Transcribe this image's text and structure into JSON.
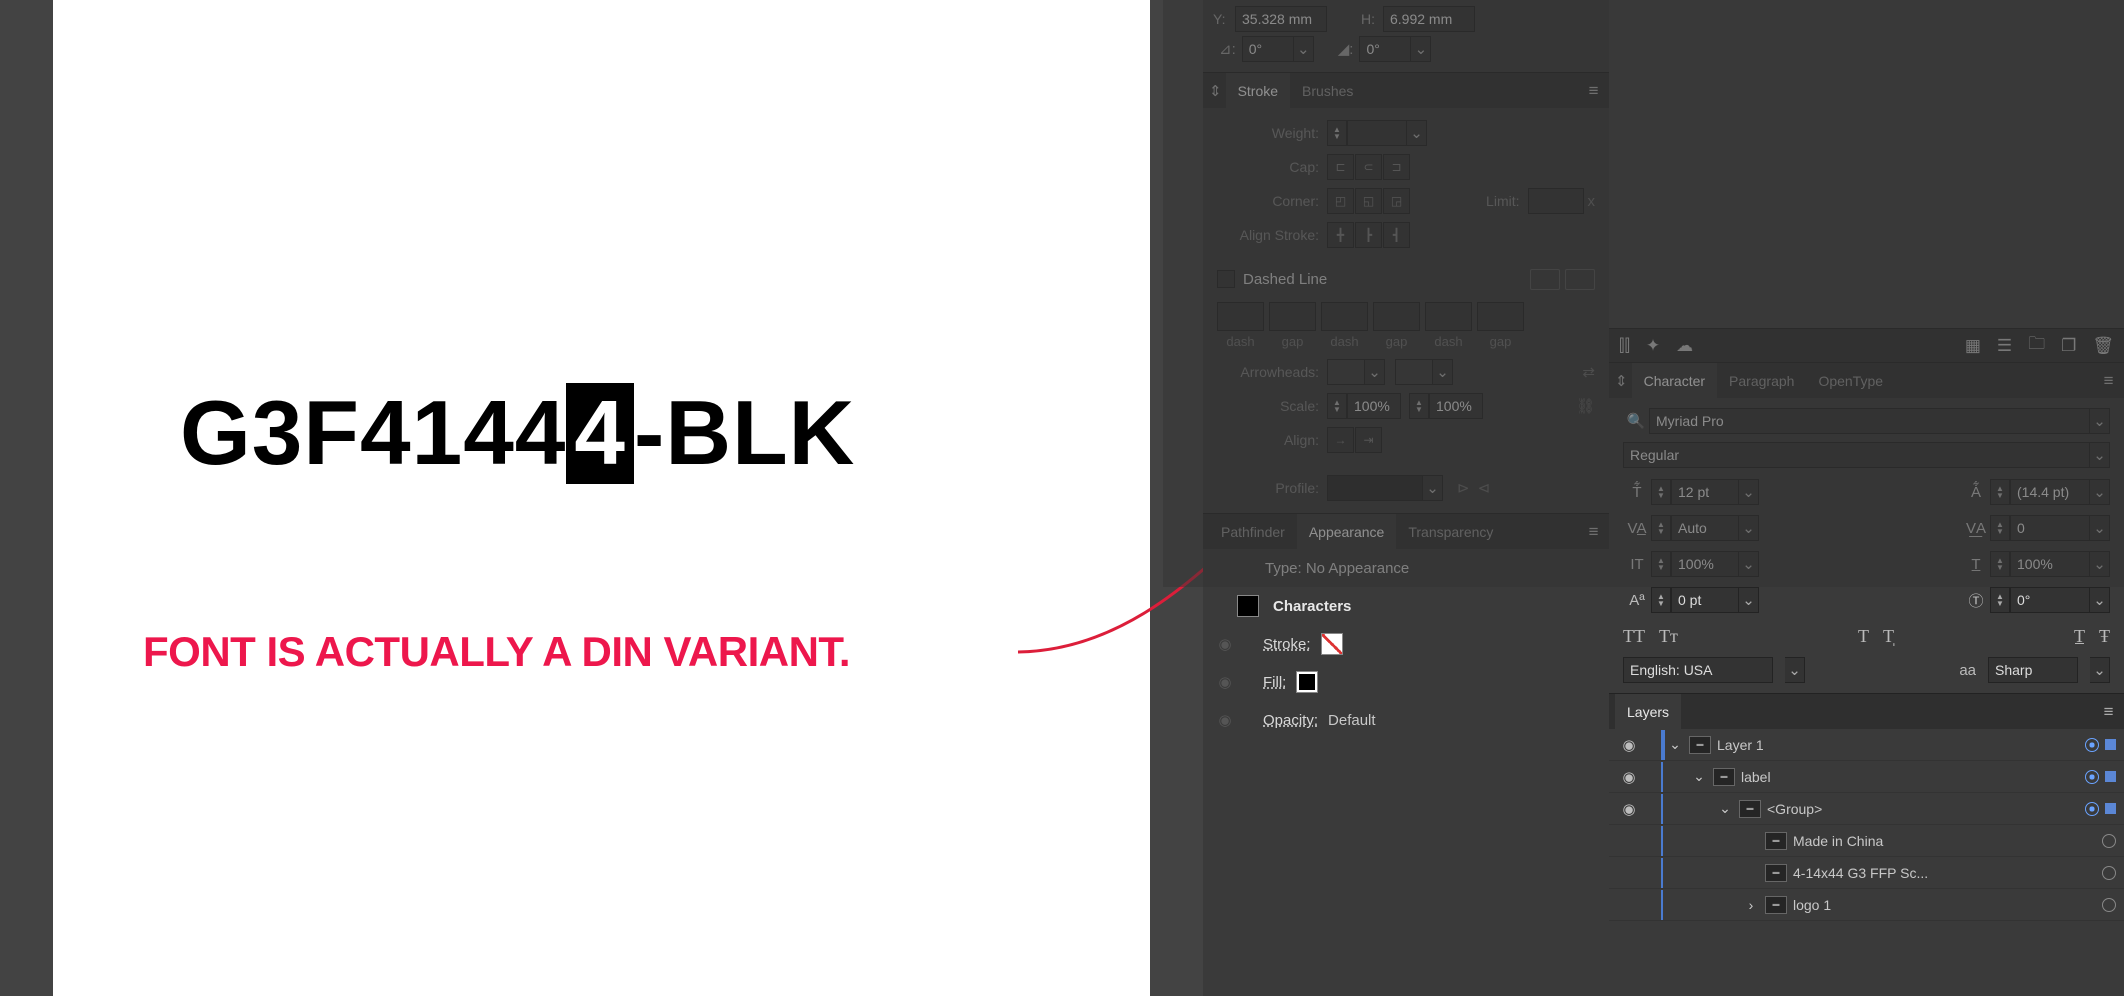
{
  "canvas": {
    "text_pre": "G3F4144",
    "text_inv": "4",
    "text_post": "-BLK",
    "annotation": "FONT IS ACTUALLY A DIN VARIANT."
  },
  "transform": {
    "y_label": "Y:",
    "y_value": "35.328 mm",
    "h_label": "H:",
    "h_value": "6.992 mm",
    "rotate": "0°",
    "shear": "0°"
  },
  "stroke_panel": {
    "tab_stroke": "Stroke",
    "tab_brushes": "Brushes",
    "weight_lbl": "Weight:",
    "cap_lbl": "Cap:",
    "corner_lbl": "Corner:",
    "limit_lbl": "Limit:",
    "align_lbl": "Align Stroke:",
    "dashed_lbl": "Dashed Line",
    "dash": "dash",
    "gap": "gap",
    "arrow_lbl": "Arrowheads:",
    "scale_lbl": "Scale:",
    "scale1": "100%",
    "scale2": "100%",
    "align2_lbl": "Align:",
    "profile_lbl": "Profile:",
    "x": "x"
  },
  "appearance_panel": {
    "tab_pathfinder": "Pathfinder",
    "tab_appearance": "Appearance",
    "tab_transparency": "Transparency",
    "type_line": "Type: No Appearance",
    "characters": "Characters",
    "stroke": "Stroke:",
    "fill": "Fill:",
    "opacity": "Opacity:",
    "opacity_val": "Default"
  },
  "character_panel": {
    "tab_character": "Character",
    "tab_paragraph": "Paragraph",
    "tab_opentype": "OpenType",
    "font": "Myriad Pro",
    "style": "Regular",
    "size": "12 pt",
    "leading": "(14.4 pt)",
    "kerning": "Auto",
    "tracking": "0",
    "vscale": "100%",
    "hscale": "100%",
    "baseline": "0 pt",
    "rotation": "0°",
    "language": "English: USA",
    "aa": "Sharp",
    "aa_lbl": "aa"
  },
  "layers_panel": {
    "tab": "Layers",
    "items": [
      {
        "name": "Layer 1",
        "depth": 0,
        "expand": "⌄",
        "sel": true
      },
      {
        "name": "label",
        "depth": 1,
        "expand": "⌄",
        "sel": true
      },
      {
        "name": "<Group>",
        "depth": 2,
        "expand": "⌄",
        "sel": true
      },
      {
        "name": "Made in China",
        "depth": 3,
        "expand": "",
        "sel": false
      },
      {
        "name": "4-14x44 G3 FFP Sc...",
        "depth": 3,
        "expand": "",
        "sel": false
      },
      {
        "name": "logo 1",
        "depth": 3,
        "expand": "›",
        "sel": false
      }
    ]
  }
}
